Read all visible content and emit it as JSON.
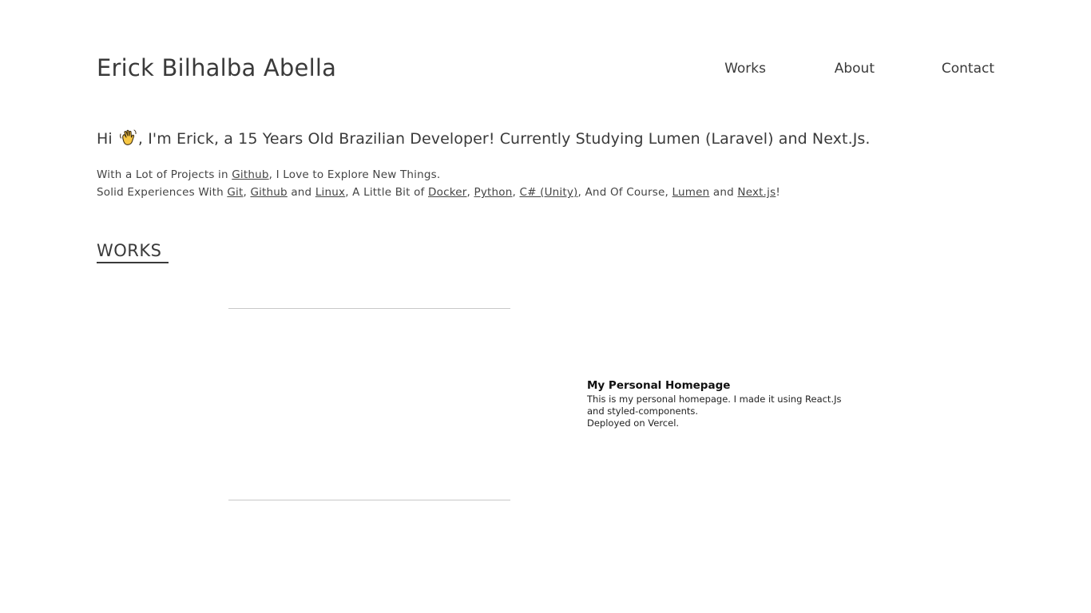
{
  "header": {
    "site_title": "Erick Bilhalba Abella",
    "nav": {
      "works": "Works",
      "about": "About",
      "contact": "Contact"
    }
  },
  "hero": {
    "headline_prefix": "Hi",
    "headline_icon": "waving-hand-icon",
    "headline_suffix": ", I'm Erick, a 15 Years Old Brazilian Developer! Currently Studying Lumen (Laravel) and Next.Js."
  },
  "intro": {
    "line1_prefix": "With a Lot of Projects in ",
    "line1_link": "Github",
    "line1_suffix": ", I Love to Explore New Things.",
    "line2_prefix": "Solid Experiences With ",
    "git": "Git",
    "sep1": ", ",
    "github": "Github",
    "and1": " and ",
    "linux": "Linux",
    "mid": ", A Little Bit of ",
    "docker": "Docker",
    "sep2": ", ",
    "python": "Python",
    "sep3": ", ",
    "csharp": "C# (Unity)",
    "course": ", And Of Course, ",
    "lumen": "Lumen",
    "and2": " and ",
    "nextjs": "Next.js",
    "end": "!"
  },
  "works": {
    "heading": "WORKS",
    "items": [
      {
        "title": "My Personal Homepage",
        "description": "This is my personal homepage. I made it using React.Js and styled-components.",
        "deploy": "Deployed on Vercel."
      }
    ]
  },
  "colors": {
    "text": "#3a3a3a",
    "background": "#ffffff",
    "divider": "#c8c8c8",
    "wave_yellow": "#f7c744"
  }
}
